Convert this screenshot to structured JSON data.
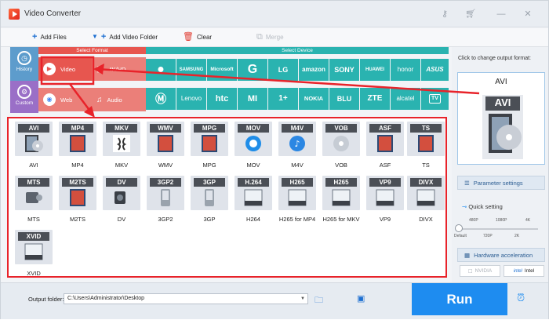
{
  "window": {
    "title": "Video Converter"
  },
  "toolbar": {
    "add_files": "Add Files",
    "add_video_folder": "Add Video Folder",
    "clear": "Clear",
    "merge": "Merge"
  },
  "categories": {
    "history": "History",
    "custom": "Custom"
  },
  "headers": {
    "select_format": "Select Format",
    "select_device": "Select Device"
  },
  "format_tabs": {
    "video": "Video",
    "hd": "4K/HD",
    "web": "Web",
    "audio": "Audio"
  },
  "devices": {
    "row1": [
      "",
      "SAMSUNG",
      "Microsoft",
      "G",
      "LG",
      "amazon",
      "SONY",
      "HUAWEI",
      "honor",
      "ASUS"
    ],
    "row2": [
      "",
      "Lenovo",
      "htc",
      "MI",
      "1+",
      "NOKIA",
      "BLU",
      "ZTE",
      "alcatel",
      "TV"
    ]
  },
  "formats": {
    "row1": [
      "AVI",
      "MP4",
      "MKV",
      "WMV",
      "MPG",
      "MOV",
      "M4V",
      "VOB",
      "ASF",
      "TS"
    ],
    "row2": [
      "MTS",
      "M2TS",
      "DV",
      "3GP2",
      "3GP",
      "H264",
      "H265 for MP4",
      "H265 for MKV",
      "VP9",
      "DIVX"
    ],
    "row3": [
      "XVID"
    ],
    "tile_headers_row2": [
      "MTS",
      "M2TS",
      "DV",
      "3GP2",
      "3GP",
      "H.264",
      "H265",
      "H265",
      "VP9",
      "DIVX"
    ],
    "tile_headers_row3": [
      "XVID"
    ]
  },
  "right_panel": {
    "hint": "Click to change output format:",
    "output_format": "AVI",
    "output_badge": "AVI",
    "parameter_settings": "Parameter settings",
    "quick_setting": "Quick setting",
    "quality_ticks_top": [
      "480P",
      "1080P",
      "4K"
    ],
    "quality_ticks_bottom": [
      "Default",
      "720P",
      "2K"
    ],
    "hardware_acceleration": "Hardware acceleration",
    "nvidia": "NVIDIA",
    "intel": "Intel"
  },
  "bottom": {
    "output_folder_label": "Output folder:",
    "output_folder_value": "C:\\Users\\Administrator\\Desktop",
    "run": "Run"
  },
  "colors": {
    "format_red": "#e7564f",
    "device_teal": "#2ab3b0",
    "category_blue": "#5d9ccc",
    "run_blue": "#1e8cf0",
    "annotation_red": "#e8232a"
  }
}
